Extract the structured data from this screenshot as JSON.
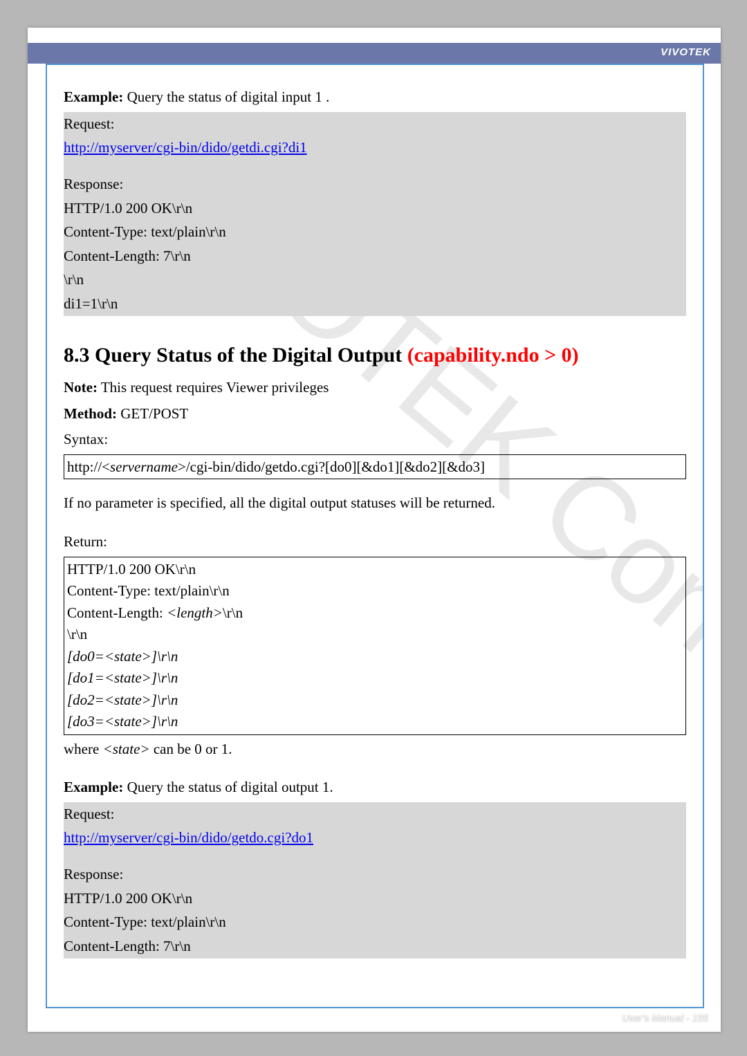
{
  "brand": "VIVOTEK",
  "watermark": "VIVOTEK Confidential",
  "example1": {
    "label": "Example:",
    "text": " Query the status of digital input 1 .",
    "request_label": "Request:",
    "request_url": "http://myserver/cgi-bin/dido/getdi.cgi?di1",
    "response_label": "Response:",
    "resp_line1": "HTTP/1.0 200 OK\\r\\n",
    "resp_line2": "Content-Type: text/plain\\r\\n",
    "resp_line3": "Content-Length: 7\\r\\n",
    "resp_line4": "\\r\\n",
    "resp_line5": "di1=1\\r\\n"
  },
  "section": {
    "num": "8.3 Query Status of the Digital Output ",
    "red": "(capability.ndo > 0)",
    "note_label": "Note:",
    "note_text": " This request requires Viewer privileges",
    "method_label": "Method:",
    "method_text": " GET/POST",
    "syntax_label": "Syntax:",
    "syntax_prefix": "http://<",
    "syntax_server": "servername",
    "syntax_suffix": ">/cgi-bin/dido/getdo.cgi?[do0][&do1][&do2][&do3]",
    "no_param": "If no parameter is specified, all the digital output statuses will be returned.",
    "return_label": "Return:",
    "ret_line1": "HTTP/1.0 200 OK\\r\\n",
    "ret_line2": "Content-Type: text/plain\\r\\n",
    "ret_line3a": "Content-Length: ",
    "ret_line3b": "<length>",
    "ret_line3c": "\\r\\n",
    "ret_line4": "\\r\\n",
    "ret_do0": "[do0=<state>]\\r\\n",
    "ret_do1": "[do1=<state>]\\r\\n",
    "ret_do2": "[do2=<state>]\\r\\n",
    "ret_do3": "[do3=<state>]\\r\\n",
    "where_a": "where ",
    "where_b": "<state>",
    "where_c": " can be 0 or 1."
  },
  "example2": {
    "label": "Example:",
    "text": " Query the status of digital output 1.",
    "request_label": "Request:",
    "request_url": "http://myserver/cgi-bin/dido/getdo.cgi?do1",
    "response_label": "Response:",
    "resp_line1": "HTTP/1.0 200 OK\\r\\n",
    "resp_line2": "Content-Type: text/plain\\r\\n",
    "resp_line3": "Content-Length: 7\\r\\n"
  },
  "footer": "User's Manual - 155"
}
